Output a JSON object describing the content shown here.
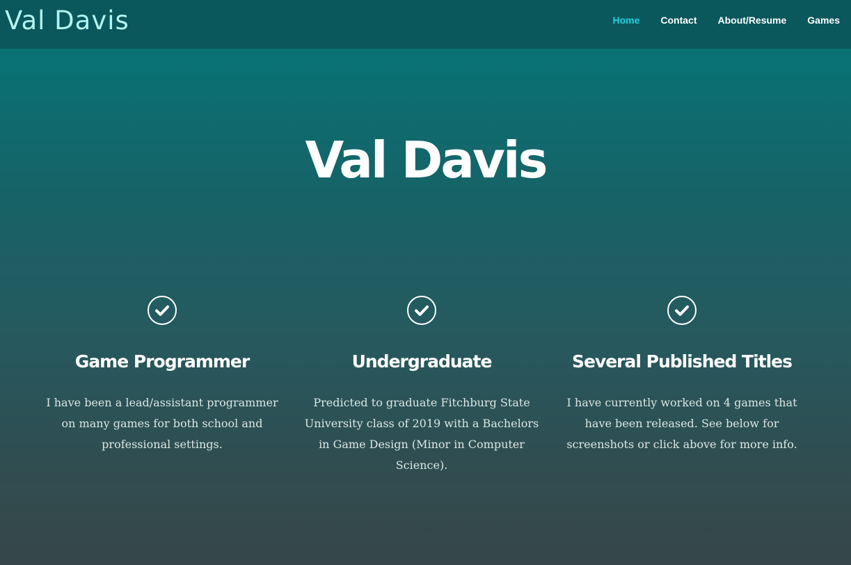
{
  "header": {
    "brand": "Val Davis",
    "nav": [
      {
        "label": "Home",
        "active": true
      },
      {
        "label": "Contact",
        "active": false
      },
      {
        "label": "About/Resume",
        "active": false
      },
      {
        "label": "Games",
        "active": false
      }
    ]
  },
  "hero": {
    "title": "Val Davis"
  },
  "features": [
    {
      "icon": "check-circle-icon",
      "title": "Game Programmer",
      "text": "I have been a lead/assistant programmer on many games for both school and professional settings."
    },
    {
      "icon": "check-circle-icon",
      "title": "Undergraduate",
      "text": "Predicted to graduate Fitchburg State University class of 2019 with a Bachelors in Game Design (Minor in Computer Science)."
    },
    {
      "icon": "check-circle-icon",
      "title": "Several Published Titles",
      "text": "I have currently worked on 4 games that have been released. See below for screenshots or click above for more info."
    }
  ],
  "colors": {
    "header_bg": "#0a575c",
    "brand": "#b2f4ef",
    "nav_active": "#22d0e0",
    "nav_text": "#ffffff",
    "gradient_top": "#07797a",
    "gradient_bottom": "#374648"
  }
}
